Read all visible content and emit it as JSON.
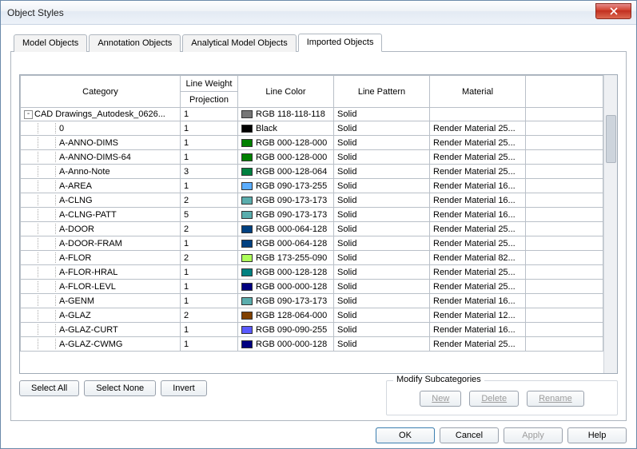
{
  "title": "Object Styles",
  "tabs": [
    {
      "label": "Model Objects",
      "active": false
    },
    {
      "label": "Annotation Objects",
      "active": false
    },
    {
      "label": "Analytical Model Objects",
      "active": false
    },
    {
      "label": "Imported Objects",
      "active": true
    }
  ],
  "columns": {
    "category": "Category",
    "lineweight": "Line Weight",
    "projection": "Projection",
    "linecolor": "Line Color",
    "linepattern": "Line Pattern",
    "material": "Material"
  },
  "rows": [
    {
      "indent": 0,
      "exp": "-",
      "name": "CAD Drawings_Autodesk_0626...",
      "lw": "1",
      "swatch": "#767676",
      "color": "RGB 118-118-118",
      "pattern": "Solid",
      "material": ""
    },
    {
      "indent": 1,
      "name": "0",
      "lw": "1",
      "swatch": "#000000",
      "color": "Black",
      "pattern": "Solid",
      "material": "Render Material 25..."
    },
    {
      "indent": 1,
      "name": "A-ANNO-DIMS",
      "lw": "1",
      "swatch": "#008000",
      "color": "RGB 000-128-000",
      "pattern": "Solid",
      "material": "Render Material 25..."
    },
    {
      "indent": 1,
      "name": "A-ANNO-DIMS-64",
      "lw": "1",
      "swatch": "#008000",
      "color": "RGB 000-128-000",
      "pattern": "Solid",
      "material": "Render Material 25..."
    },
    {
      "indent": 1,
      "name": "A-Anno-Note",
      "lw": "3",
      "swatch": "#008040",
      "color": "RGB 000-128-064",
      "pattern": "Solid",
      "material": "Render Material 25..."
    },
    {
      "indent": 1,
      "name": "A-AREA",
      "lw": "1",
      "swatch": "#5aadff",
      "color": "RGB 090-173-255",
      "pattern": "Solid",
      "material": "Render Material 16..."
    },
    {
      "indent": 1,
      "name": "A-CLNG",
      "lw": "2",
      "swatch": "#5aadad",
      "color": "RGB 090-173-173",
      "pattern": "Solid",
      "material": "Render Material 16..."
    },
    {
      "indent": 1,
      "name": "A-CLNG-PATT",
      "lw": "5",
      "swatch": "#5aadad",
      "color": "RGB 090-173-173",
      "pattern": "Solid",
      "material": "Render Material 16..."
    },
    {
      "indent": 1,
      "name": "A-DOOR",
      "lw": "2",
      "swatch": "#004080",
      "color": "RGB 000-064-128",
      "pattern": "Solid",
      "material": "Render Material 25..."
    },
    {
      "indent": 1,
      "name": "A-DOOR-FRAM",
      "lw": "1",
      "swatch": "#004080",
      "color": "RGB 000-064-128",
      "pattern": "Solid",
      "material": "Render Material 25..."
    },
    {
      "indent": 1,
      "name": "A-FLOR",
      "lw": "2",
      "swatch": "#adff5a",
      "color": "RGB 173-255-090",
      "pattern": "Solid",
      "material": "Render Material 82..."
    },
    {
      "indent": 1,
      "name": "A-FLOR-HRAL",
      "lw": "1",
      "swatch": "#008080",
      "color": "RGB 000-128-128",
      "pattern": "Solid",
      "material": "Render Material 25..."
    },
    {
      "indent": 1,
      "name": "A-FLOR-LEVL",
      "lw": "1",
      "swatch": "#000080",
      "color": "RGB 000-000-128",
      "pattern": "Solid",
      "material": "Render Material 25..."
    },
    {
      "indent": 1,
      "name": "A-GENM",
      "lw": "1",
      "swatch": "#5aadad",
      "color": "RGB 090-173-173",
      "pattern": "Solid",
      "material": "Render Material 16..."
    },
    {
      "indent": 1,
      "name": "A-GLAZ",
      "lw": "2",
      "swatch": "#804000",
      "color": "RGB 128-064-000",
      "pattern": "Solid",
      "material": "Render Material 12..."
    },
    {
      "indent": 1,
      "name": "A-GLAZ-CURT",
      "lw": "1",
      "swatch": "#5a5aff",
      "color": "RGB 090-090-255",
      "pattern": "Solid",
      "material": "Render Material 16..."
    },
    {
      "indent": 1,
      "name": "A-GLAZ-CWMG",
      "lw": "1",
      "swatch": "#000080",
      "color": "RGB 000-000-128",
      "pattern": "Solid",
      "material": "Render Material 25..."
    }
  ],
  "selection_buttons": {
    "select_all": "Select All",
    "select_none": "Select None",
    "invert": "Invert"
  },
  "modify_group": {
    "title": "Modify Subcategories",
    "new": "New",
    "delete": "Delete",
    "rename": "Rename"
  },
  "footer": {
    "ok": "OK",
    "cancel": "Cancel",
    "apply": "Apply",
    "help": "Help"
  }
}
